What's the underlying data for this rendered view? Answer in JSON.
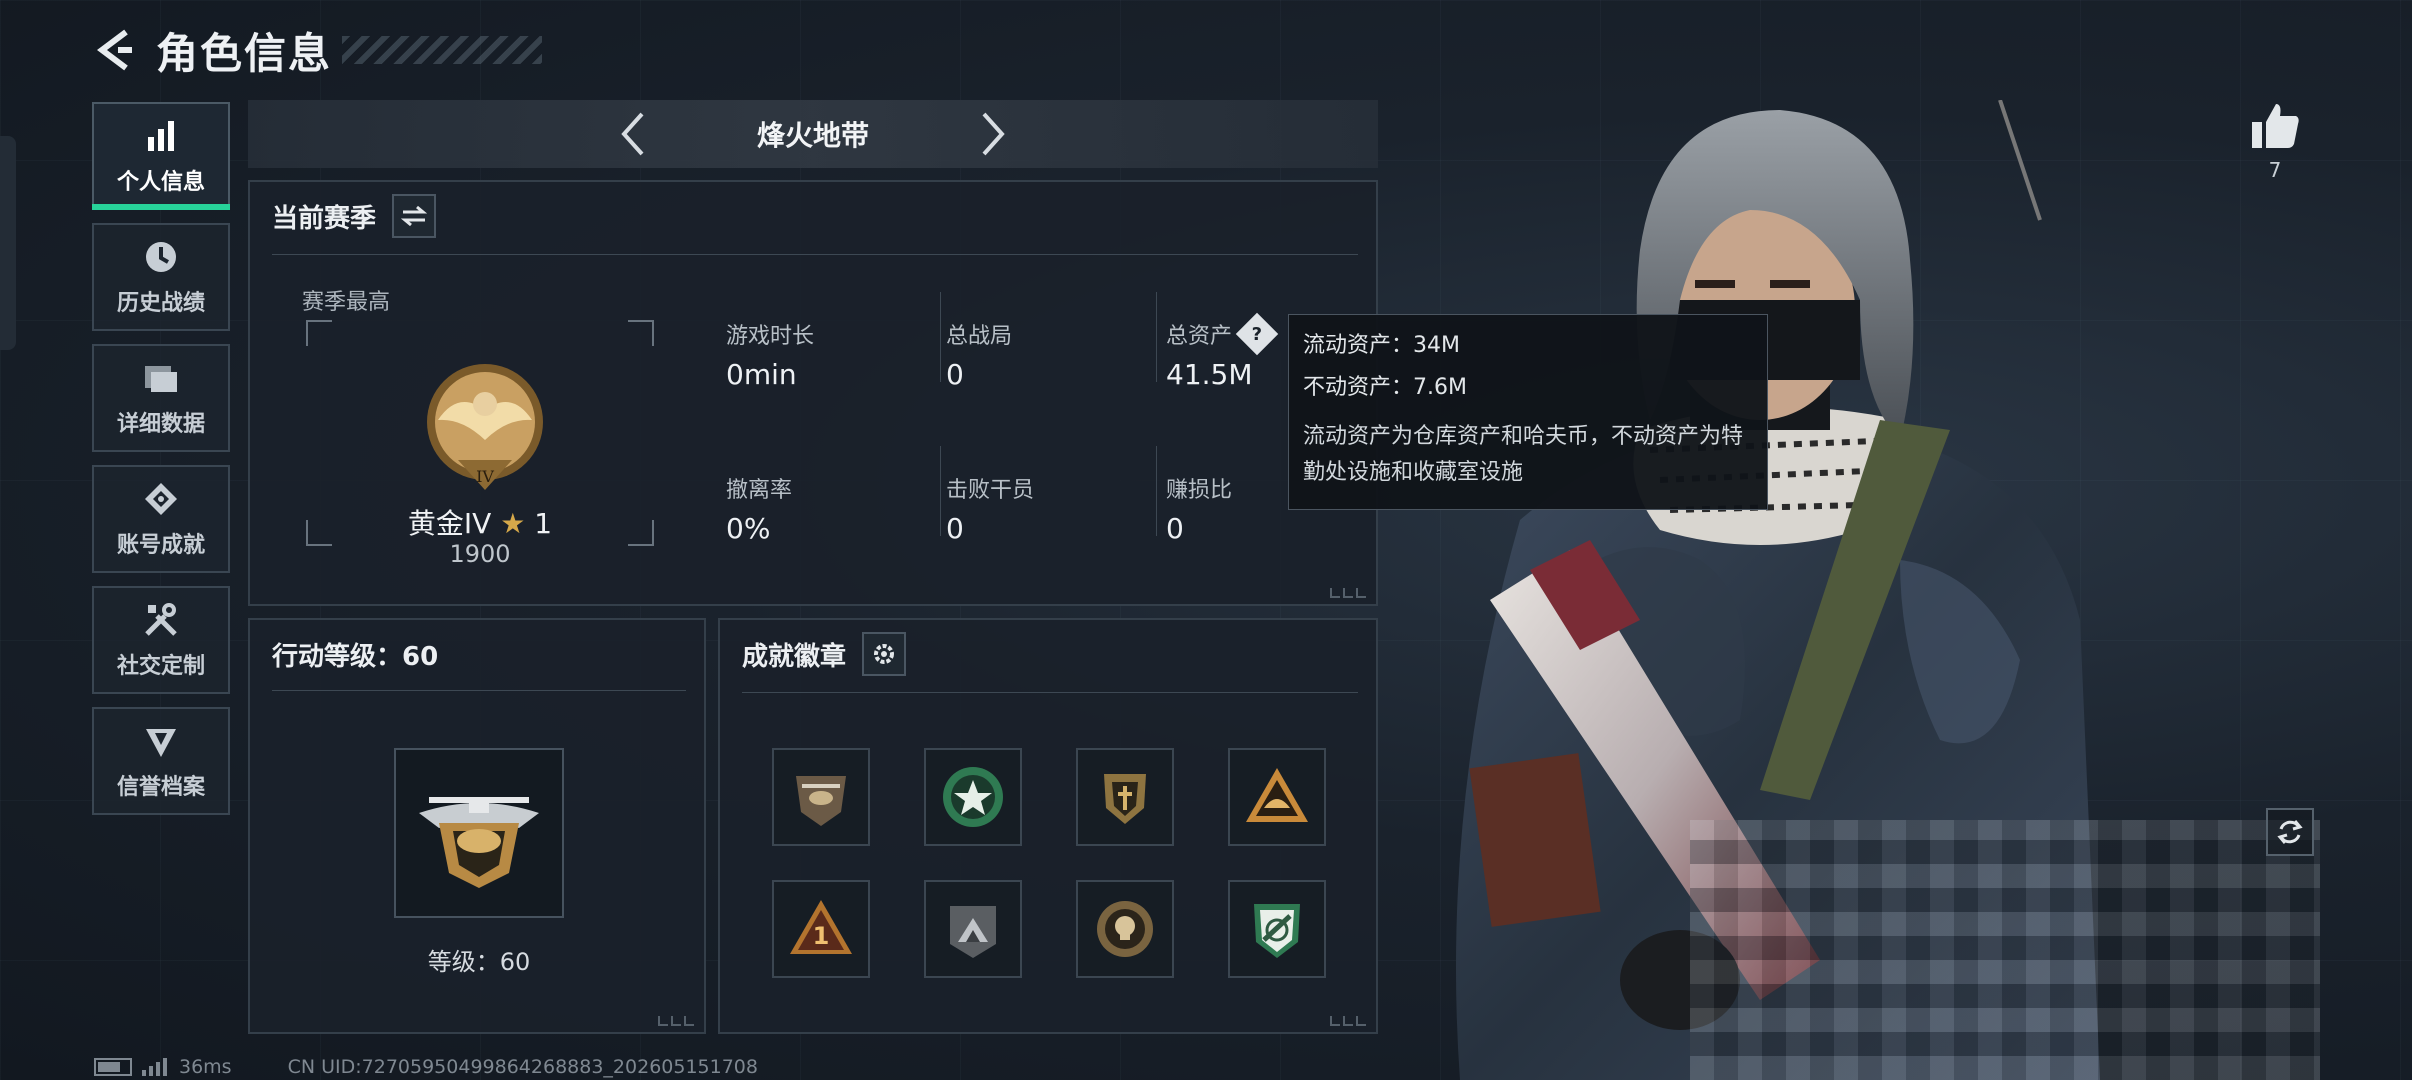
{
  "header": {
    "title": "角色信息"
  },
  "sidebar": {
    "items": [
      {
        "label": "个人信息",
        "icon": "bar-chart-icon",
        "active": true
      },
      {
        "label": "历史战绩",
        "icon": "history-clock-icon",
        "active": false
      },
      {
        "label": "详细数据",
        "icon": "folder-icon",
        "active": false
      },
      {
        "label": "账号成就",
        "icon": "achievement-diamond-icon",
        "active": false
      },
      {
        "label": "社交定制",
        "icon": "tools-icon",
        "active": false
      },
      {
        "label": "信誉档案",
        "icon": "shield-emblem-icon",
        "active": false
      }
    ]
  },
  "mode_selector": {
    "current": "烽火地带"
  },
  "season_panel": {
    "title": "当前赛季",
    "best_label": "赛季最高",
    "rank_name": "黄金IV",
    "rank_star_glyph": "★",
    "rank_stars": "1",
    "rank_score": "1900",
    "stats": [
      {
        "label": "游戏时长",
        "value": "0min"
      },
      {
        "label": "总战局",
        "value": "0"
      },
      {
        "label": "总资产",
        "value": "41.5M",
        "has_help": true
      },
      {
        "label": "撤离率",
        "value": "0%"
      },
      {
        "label": "击败干员",
        "value": "0"
      },
      {
        "label": "赚损比",
        "value": "0"
      }
    ]
  },
  "tooltip": {
    "liquid": "流动资产：34M",
    "fixed": "不动资产：7.6M",
    "description": "流动资产为仓库资产和哈夫币，不动资产为特勤处设施和收藏室设施"
  },
  "level_panel": {
    "title": "行动等级：60",
    "level_text": "等级：60"
  },
  "badge_panel": {
    "title": "成就徽章",
    "badges": [
      "helicopter-badge",
      "star-wreath-badge",
      "shield-crest-badge",
      "helmet-triangle-badge",
      "number-one-triangle-badge",
      "mountain-shield-badge",
      "skull-wings-badge",
      "rifle-shield-badge"
    ]
  },
  "likes": {
    "count": "7"
  },
  "status_bar": {
    "ping": "36ms",
    "uid": "CN UID:727059504998642688​83_202605151708"
  },
  "colors": {
    "accent_green": "#27d39a",
    "panel_bg": "#1a212a",
    "gold": "#d5a84a"
  }
}
